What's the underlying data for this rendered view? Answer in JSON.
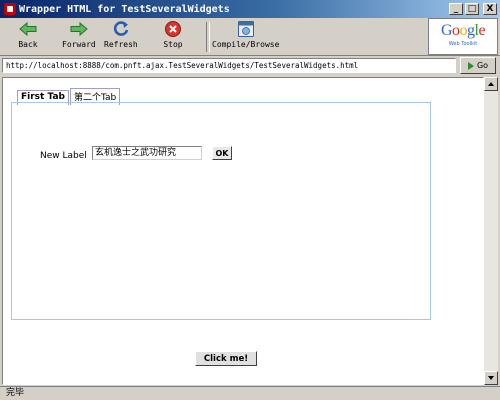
{
  "window": {
    "title": "Wrapper HTML for TestSeveralWidgets",
    "min_symbol": "_",
    "max_symbol": "□",
    "close_symbol": "X"
  },
  "toolbar": {
    "buttons": [
      {
        "label": "Back",
        "icon": "back-arrow-icon"
      },
      {
        "label": "Forward",
        "icon": "forward-arrow-icon"
      },
      {
        "label": "Refresh",
        "icon": "refresh-icon"
      },
      {
        "label": "Stop",
        "icon": "stop-icon"
      },
      {
        "label": "Compile/Browse",
        "icon": "compile-browse-icon"
      }
    ],
    "logo_word": "Google",
    "logo_sub": "Web Toolkit"
  },
  "address": {
    "url": "http://localhost:8888/com.pnft.ajax.TestSeveralWidgets/TestSeveralWidgets.html",
    "go_label": "Go"
  },
  "tabs": [
    {
      "label": "First Tab",
      "active": true
    },
    {
      "label": "第二个Tab",
      "active": false
    }
  ],
  "form": {
    "label": "New Label",
    "input_value": "玄机逸士之武功研究",
    "ok_label": "OK"
  },
  "click_button_label": "Click me!",
  "status_text": "完毕",
  "colors": {
    "accent": "#0a246a",
    "panel_border": "#a8c8e8"
  }
}
